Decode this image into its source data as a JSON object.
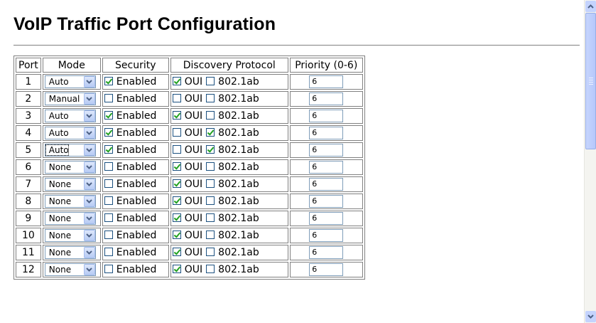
{
  "page": {
    "title": "VoIP Traffic Port Configuration"
  },
  "table": {
    "headers": {
      "port": "Port",
      "mode": "Mode",
      "security": "Security",
      "discovery": "Discovery Protocol",
      "priority": "Priority (0-6)"
    },
    "security_label": "Enabled",
    "oui_label": "OUI",
    "lldp_label": "802.1ab",
    "rows": [
      {
        "port": "1",
        "mode": "Auto",
        "security": true,
        "oui": true,
        "lldp": false,
        "priority": "6"
      },
      {
        "port": "2",
        "mode": "Manual",
        "security": false,
        "oui": false,
        "lldp": false,
        "priority": "6"
      },
      {
        "port": "3",
        "mode": "Auto",
        "security": true,
        "oui": true,
        "lldp": false,
        "priority": "6"
      },
      {
        "port": "4",
        "mode": "Auto",
        "security": true,
        "oui": false,
        "lldp": true,
        "priority": "6"
      },
      {
        "port": "5",
        "mode": "Auto",
        "security": true,
        "oui": false,
        "lldp": true,
        "priority": "6",
        "focused": true
      },
      {
        "port": "6",
        "mode": "None",
        "security": false,
        "oui": true,
        "lldp": false,
        "priority": "6"
      },
      {
        "port": "7",
        "mode": "None",
        "security": false,
        "oui": true,
        "lldp": false,
        "priority": "6"
      },
      {
        "port": "8",
        "mode": "None",
        "security": false,
        "oui": true,
        "lldp": false,
        "priority": "6"
      },
      {
        "port": "9",
        "mode": "None",
        "security": false,
        "oui": true,
        "lldp": false,
        "priority": "6"
      },
      {
        "port": "10",
        "mode": "None",
        "security": false,
        "oui": true,
        "lldp": false,
        "priority": "6"
      },
      {
        "port": "11",
        "mode": "None",
        "security": false,
        "oui": true,
        "lldp": false,
        "priority": "6"
      },
      {
        "port": "12",
        "mode": "None",
        "security": false,
        "oui": true,
        "lldp": false,
        "priority": "6"
      }
    ]
  },
  "colors": {
    "checkmark": "#21a121",
    "control_border": "#7f9db9",
    "scrollbar": "#c4d3fd"
  },
  "icons": {
    "dropdown": "chevron-down-icon",
    "scroll_up": "arrow-up-icon",
    "scroll_down": "arrow-down-icon"
  }
}
